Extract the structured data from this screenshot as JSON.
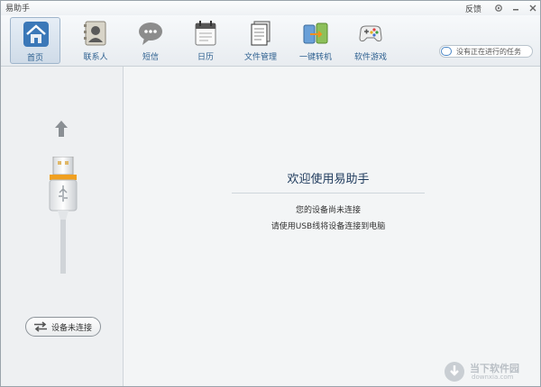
{
  "app": {
    "title": "易助手",
    "feedback": "反馈",
    "controls": [
      "gear-icon",
      "minimize-icon",
      "close-icon"
    ]
  },
  "toolbar": {
    "items": [
      {
        "label": "首页",
        "icon": "home-icon",
        "active": true
      },
      {
        "label": "联系人",
        "icon": "contacts-icon",
        "active": false
      },
      {
        "label": "短信",
        "icon": "sms-icon",
        "active": false
      },
      {
        "label": "日历",
        "icon": "calendar-icon",
        "active": false
      },
      {
        "label": "文件管理",
        "icon": "file-manager-icon",
        "active": false
      },
      {
        "label": "一键转机",
        "icon": "one-key-transfer-icon",
        "active": false
      },
      {
        "label": "软件游戏",
        "icon": "gamepad-icon",
        "active": false
      }
    ],
    "task_status": "没有正在进行的任务"
  },
  "left": {
    "status_button": "设备未连接",
    "icons": [
      "up-arrow-icon",
      "usb-cable-icon",
      "swap-arrows-icon"
    ]
  },
  "main": {
    "welcome": "欢迎使用易助手",
    "line1": "您的设备尚未连接",
    "line2": "请使用USB线将设备连接到电脑"
  },
  "watermark": {
    "name": "当下软件园",
    "url": "downxia.com"
  },
  "colors": {
    "accent": "#2c5f8f",
    "toggle": "#4a86c5",
    "usb_orange": "#f0a020"
  }
}
